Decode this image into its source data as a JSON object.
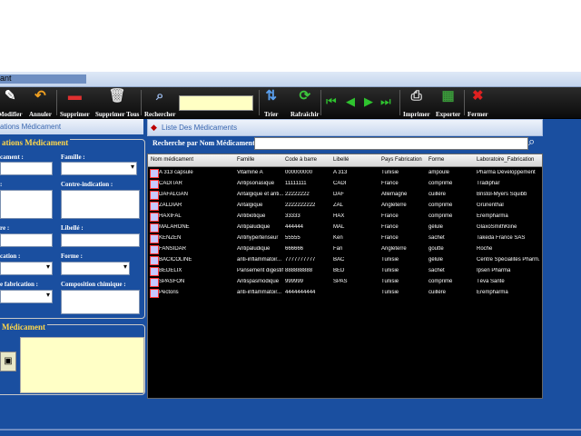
{
  "window": {
    "title_fragment": "ant"
  },
  "toolbar": {
    "items": [
      {
        "label": "Modifier",
        "icon": "edit-icon",
        "glyph": "✎"
      },
      {
        "label": "Annuler",
        "icon": "undo-icon",
        "glyph": "↶"
      },
      {
        "label": "Supprimer",
        "icon": "minus-icon",
        "glyph": "▬"
      },
      {
        "label": "Supprimer Tous",
        "icon": "trash-icon",
        "glyph": "🗑"
      },
      {
        "label": "Rechercher",
        "icon": "search-icon",
        "glyph": "⌕"
      },
      {
        "label": "Trier",
        "icon": "sort-icon",
        "glyph": "⇅"
      },
      {
        "label": "Rafraîchir",
        "icon": "refresh-icon",
        "glyph": "⟳"
      },
      {
        "label": "Imprimer",
        "icon": "printer-icon",
        "glyph": "⎙"
      },
      {
        "label": "Exporter",
        "icon": "export-icon",
        "glyph": "▦"
      },
      {
        "label": "Fermer",
        "icon": "close-icon",
        "glyph": "✖"
      }
    ],
    "nav": [
      "⏮",
      "◀",
      "▶",
      "⏭"
    ]
  },
  "left": {
    "tab_label": "ations Médicament",
    "fieldset1_title": "ations Médicament",
    "fieldset2_title": "Médicament",
    "labels": {
      "nom": "cament :",
      "famille": "Famille :",
      "indication": ":",
      "contre": "Contre-indication :",
      "libelle_left": "re :",
      "libelle": "Libellé :",
      "fabrication": "cation :",
      "forme": "Forme :",
      "pays": "e fabrication :",
      "composition": "Composition chimique :"
    }
  },
  "right": {
    "tab_label": "Liste Des Médicaments",
    "search_label": "Recherche par Nom Médicament",
    "search_value": ""
  },
  "table": {
    "columns": [
      "Nom médicament",
      "Famille",
      "Code à barre",
      "Libellé",
      "Pays Fabrication",
      "Forme",
      "Laboratoire_Fabrication"
    ],
    "rows": [
      [
        "A 313 capsule",
        "Vitamine A",
        "000000000",
        "A 313",
        "Tunisie",
        "ampoule",
        "Pharma Développement"
      ],
      [
        "CADITAR",
        "Antipsoriasique",
        "11111111",
        "CADI",
        "France",
        "comprimé",
        "Tradiphar"
      ],
      [
        "DAFALGAN",
        "Antalgique et anti...",
        "22222222",
        "DAF",
        "Allemagne",
        "cuillère",
        "Bristol-Myers Squibb"
      ],
      [
        "ZALDIAR",
        "Antalgique",
        "2222222222",
        "ZAL",
        "Angleterre",
        "comprimé",
        "Grünenthal"
      ],
      [
        "HAXIFAL",
        "Antibiotique",
        "33333",
        "HAX",
        "France",
        "comprimé",
        "Erempharma"
      ],
      [
        "MALARONE",
        "Antipaludique",
        "444444",
        "MAL",
        "France",
        "gélule",
        "GlaxoSmithKline"
      ],
      [
        "KENZEN",
        "Antihypertenseur",
        "55555",
        "Ken",
        "France",
        "sachet",
        "Takeda France SAS"
      ],
      [
        "FANSIDAR",
        "Antipaludique",
        "666666",
        "Fan",
        "Angleterre",
        "goutte",
        "Roche"
      ],
      [
        "BACICOLINE",
        "anti-inflammatoir...",
        "7777777777",
        "BAC",
        "Tunisie",
        "gélule",
        "Centre Spécialités Pharm..."
      ],
      [
        "BEDELIX",
        "Pansement digestif",
        "888888888",
        "BED",
        "Tunisie",
        "sachet",
        "Ipsen Pharma"
      ],
      [
        "SPASFON",
        "Antispasmodique",
        "999999",
        "SPAS",
        "Tunisie",
        "comprimé",
        "Téva Santé"
      ],
      [
        "Pectoris",
        "anti-inflammatoir...",
        "4444444444",
        "",
        "Tunisie",
        "cuillère",
        "Erempharma"
      ]
    ]
  }
}
